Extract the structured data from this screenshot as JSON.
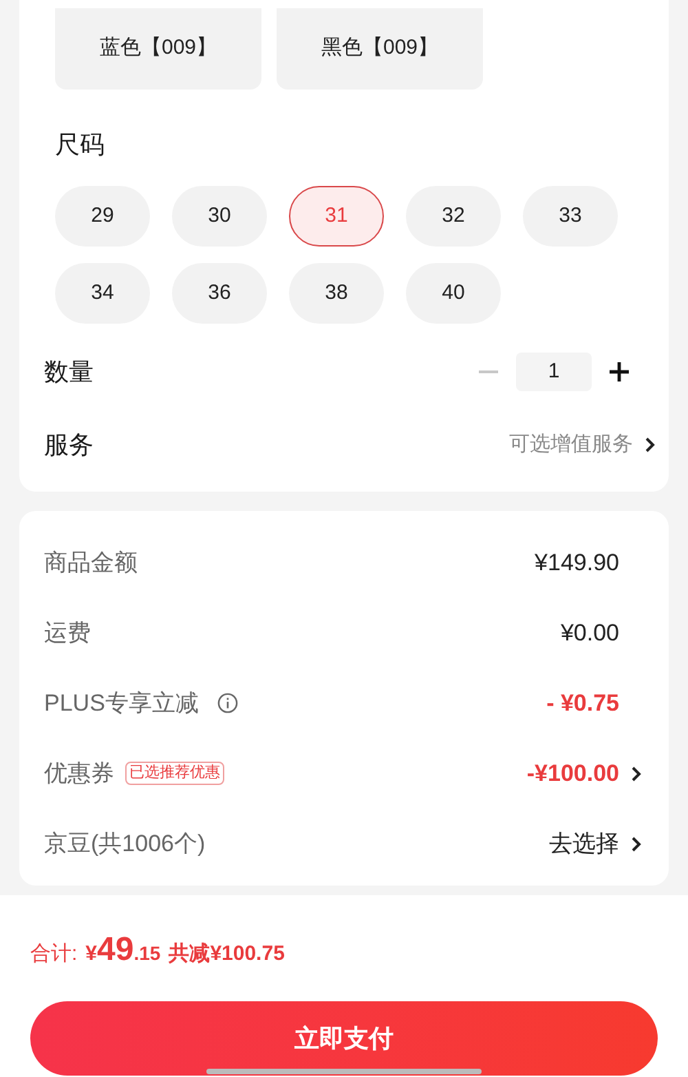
{
  "colors": [
    {
      "label": "蓝色【009】",
      "selected": false
    },
    {
      "label": "黑色【009】",
      "selected": false
    }
  ],
  "size_section": {
    "title": "尺码",
    "options": [
      {
        "label": "29",
        "selected": false
      },
      {
        "label": "30",
        "selected": false
      },
      {
        "label": "31",
        "selected": true
      },
      {
        "label": "32",
        "selected": false
      },
      {
        "label": "33",
        "selected": false
      },
      {
        "label": "34",
        "selected": false
      },
      {
        "label": "36",
        "selected": false
      },
      {
        "label": "38",
        "selected": false
      },
      {
        "label": "40",
        "selected": false
      }
    ]
  },
  "quantity": {
    "label": "数量",
    "value": "1",
    "decrement_disabled": true
  },
  "service": {
    "label": "服务",
    "value": "可选增值服务"
  },
  "fees": [
    {
      "label": "商品金额",
      "value": "¥149.90",
      "highlight": false,
      "info": false,
      "chevron": false
    },
    {
      "label": "运费",
      "value": "¥0.00",
      "highlight": false,
      "info": false,
      "chevron": false
    },
    {
      "label": "PLUS专享立减",
      "value": "- ¥0.75",
      "highlight": true,
      "info": true,
      "chevron": false
    },
    {
      "label": "优惠券",
      "tag": "已选推荐优惠",
      "value": "-¥100.00",
      "highlight": true,
      "info": false,
      "chevron": true
    },
    {
      "label": "京豆(共1006个)",
      "value": "去选择",
      "highlight": false,
      "info": false,
      "chevron": true
    }
  ],
  "footer": {
    "total_label": "合计:",
    "currency": "¥",
    "total_integer": "49",
    "total_decimal": ".15",
    "saving": "共减¥100.75"
  },
  "pay_button": "立即支付"
}
